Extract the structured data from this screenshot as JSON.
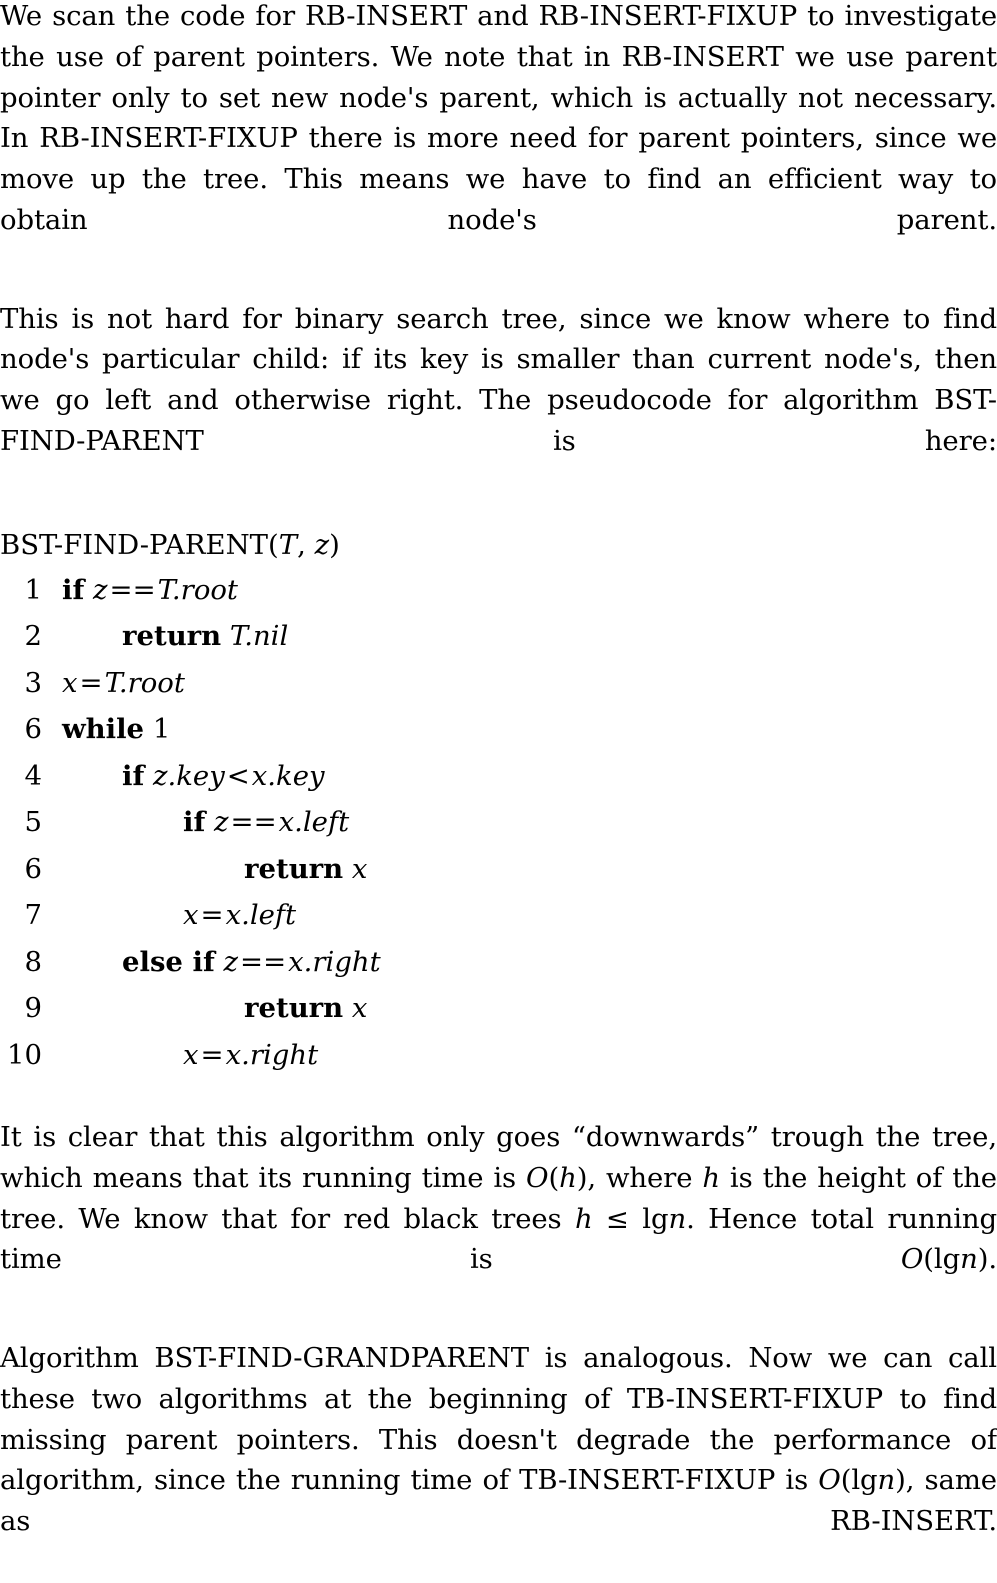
{
  "document": {
    "type": "algorithms-textbook-page",
    "font_color": "#000000",
    "background_color": "#ffffff"
  },
  "paragraphs": {
    "p1": "We scan the code for RB-INSERT and RB-INSERT-FIXUP to investigate the use of parent pointers. We note that in RB-INSERT we use parent pointer only to set new node's parent, which is actually not necessary. In RB-INSERT-FIXUP there is more need for parent pointers, since we move up the tree. This means we have to find an efficient way to obtain node's parent.",
    "p2": "This is not hard for binary search tree, since we know where to find node's particular child: if its key is smaller than current node's, then we go left and otherwise right. The pseudocode for algorithm BST-FIND-PARENT is here:",
    "p4_a": "It is clear that this algorithm only goes “downwards” trough the tree, which means that its running time is ",
    "p4_O": "O",
    "p4_paren_open": "(",
    "p4_h1": "h",
    "p4_paren_close": ")",
    "p4_b": ", where ",
    "p4_h2": "h",
    "p4_c": " is the height of the tree. We know that for red black trees ",
    "p4_h3": "h",
    "p4_le": " ≤ ",
    "p4_lg": "lg",
    "p4_n1": "n",
    "p4_d": ". Hence total running time is ",
    "p4_O2": "O",
    "p4_lg2": "(lg",
    "p4_n2": "n",
    "p4_e": ").",
    "p5_a": "Algorithm BST-FIND-GRANDPARENT is analogous. Now we can call these two algorithms at the beginning of TB-INSERT-FIXUP to find missing parent pointers. This doesn't degrade the performance of algorithm, since the running time of TB-INSERT-FIXUP is ",
    "p5_O": "O",
    "p5_lg": "(lg",
    "p5_n": "n",
    "p5_b": "), same as RB-INSERT."
  },
  "pseudocode": {
    "title_name": "BST-FIND-PARENT",
    "title_paren_open": "(",
    "title_arg1": "T",
    "title_comma": ", ",
    "title_arg2": "z",
    "title_paren_close": ")",
    "lines": [
      {
        "number": "1",
        "indent": 0,
        "tokens": [
          {
            "t": "kw",
            "v": "if"
          },
          {
            "t": "sp",
            "v": " "
          },
          {
            "t": "var",
            "v": "z"
          },
          {
            "t": "op",
            "v": "=="
          },
          {
            "t": "var",
            "v": "T.root"
          }
        ]
      },
      {
        "number": "2",
        "indent": 1,
        "tokens": [
          {
            "t": "kw",
            "v": "return"
          },
          {
            "t": "sp",
            "v": " "
          },
          {
            "t": "var",
            "v": "T.nil"
          }
        ]
      },
      {
        "number": "3",
        "indent": 0,
        "tokens": [
          {
            "t": "var",
            "v": "x"
          },
          {
            "t": "op",
            "v": "="
          },
          {
            "t": "var",
            "v": "T.root"
          }
        ]
      },
      {
        "number": "6",
        "indent": 0,
        "tokens": [
          {
            "t": "kw",
            "v": "while"
          },
          {
            "t": "sp",
            "v": " "
          },
          {
            "t": "num",
            "v": "1"
          }
        ]
      },
      {
        "number": "4",
        "indent": 1,
        "tokens": [
          {
            "t": "kw",
            "v": "if"
          },
          {
            "t": "sp",
            "v": " "
          },
          {
            "t": "var",
            "v": "z.key"
          },
          {
            "t": "op",
            "v": "<"
          },
          {
            "t": "var",
            "v": "x.key"
          }
        ]
      },
      {
        "number": "5",
        "indent": 2,
        "tokens": [
          {
            "t": "kw",
            "v": "if"
          },
          {
            "t": "sp",
            "v": " "
          },
          {
            "t": "var",
            "v": "z"
          },
          {
            "t": "op",
            "v": "=="
          },
          {
            "t": "var",
            "v": "x.left"
          }
        ]
      },
      {
        "number": "6",
        "indent": 3,
        "tokens": [
          {
            "t": "kw",
            "v": "return"
          },
          {
            "t": "sp",
            "v": " "
          },
          {
            "t": "var",
            "v": "x"
          }
        ]
      },
      {
        "number": "7",
        "indent": 2,
        "tokens": [
          {
            "t": "var",
            "v": "x"
          },
          {
            "t": "op",
            "v": "="
          },
          {
            "t": "var",
            "v": "x.left"
          }
        ]
      },
      {
        "number": "8",
        "indent": 1,
        "tokens": [
          {
            "t": "kw",
            "v": "else if"
          },
          {
            "t": "sp",
            "v": " "
          },
          {
            "t": "var",
            "v": "z"
          },
          {
            "t": "op",
            "v": "=="
          },
          {
            "t": "var",
            "v": "x.right"
          }
        ]
      },
      {
        "number": "9",
        "indent": 3,
        "tokens": [
          {
            "t": "kw",
            "v": "return"
          },
          {
            "t": "sp",
            "v": " "
          },
          {
            "t": "var",
            "v": "x"
          }
        ]
      },
      {
        "number": "10",
        "indent": 2,
        "tokens": [
          {
            "t": "var",
            "v": "x"
          },
          {
            "t": "op",
            "v": "="
          },
          {
            "t": "var",
            "v": "x.right"
          }
        ]
      }
    ]
  }
}
